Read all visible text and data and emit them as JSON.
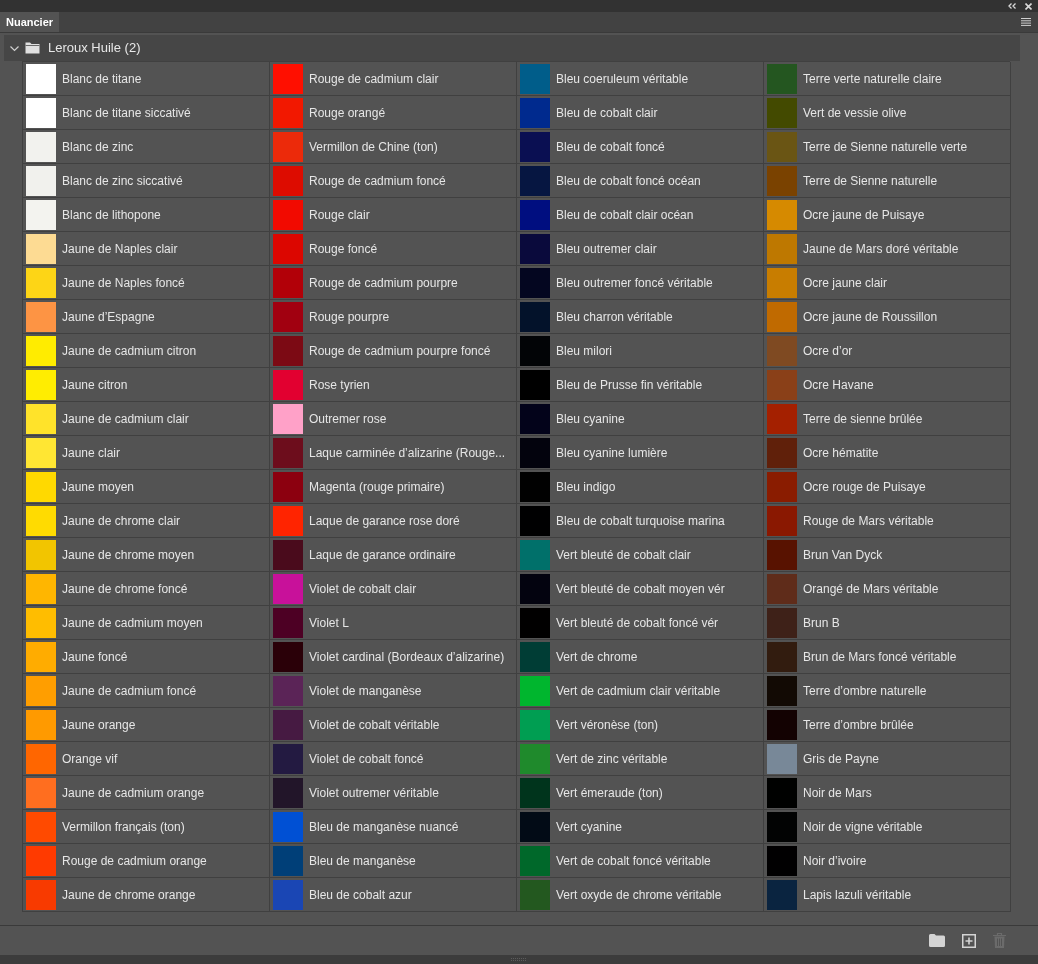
{
  "tabs": [
    {
      "label": "Nuancier",
      "selected": true
    }
  ],
  "group": {
    "name": "Leroux Huile (2)",
    "expanded": true
  },
  "swatches": [
    {
      "name": "Blanc de titane",
      "color": "#ffffff"
    },
    {
      "name": "Blanc de titane siccativé",
      "color": "#ffffff"
    },
    {
      "name": "Blanc de zinc",
      "color": "#f2f2ee"
    },
    {
      "name": "Blanc de zinc siccativé",
      "color": "#f1f1ed"
    },
    {
      "name": "Blanc de lithopone",
      "color": "#f3f3ef"
    },
    {
      "name": "Jaune de Naples clair",
      "color": "#fddb93"
    },
    {
      "name": "Jaune de Naples foncé",
      "color": "#fdd516"
    },
    {
      "name": "Jaune d’Espagne",
      "color": "#fd9444"
    },
    {
      "name": "Jaune de cadmium citron",
      "color": "#ffec00"
    },
    {
      "name": "Jaune citron",
      "color": "#ffed01"
    },
    {
      "name": "Jaune de cadmium clair",
      "color": "#ffe32a"
    },
    {
      "name": "Jaune clair",
      "color": "#ffe633"
    },
    {
      "name": "Jaune moyen",
      "color": "#ffd900"
    },
    {
      "name": "Jaune de chrome clair",
      "color": "#ffdb01"
    },
    {
      "name": "Jaune de chrome moyen",
      "color": "#f2c500"
    },
    {
      "name": "Jaune de chrome foncé",
      "color": "#ffb600"
    },
    {
      "name": "Jaune de cadmium moyen",
      "color": "#ffbd00"
    },
    {
      "name": "Jaune foncé",
      "color": "#ffac00"
    },
    {
      "name": "Jaune de cadmium foncé",
      "color": "#ff9e00"
    },
    {
      "name": "Jaune orange",
      "color": "#ff9a00"
    },
    {
      "name": "Orange vif",
      "color": "#ff6600"
    },
    {
      "name": "Jaune de cadmium orange",
      "color": "#ff6e1f"
    },
    {
      "name": "Vermillon français (ton)",
      "color": "#ff4a00"
    },
    {
      "name": "Rouge de cadmium orange",
      "color": "#ff3a00"
    },
    {
      "name": "Jaune de chrome orange",
      "color": "#f83a00"
    },
    {
      "name": "Rouge de cadmium clair",
      "color": "#ff0f00"
    },
    {
      "name": "Rouge orangé",
      "color": "#f21800"
    },
    {
      "name": "Vermillon de Chine (ton)",
      "color": "#ec2a0a"
    },
    {
      "name": "Rouge de cadmium foncé",
      "color": "#dd0c00"
    },
    {
      "name": "Rouge clair",
      "color": "#f20a00"
    },
    {
      "name": "Rouge foncé",
      "color": "#dc0600"
    },
    {
      "name": "Rouge de cadmium pourpre",
      "color": "#b20008"
    },
    {
      "name": "Rouge pourpre",
      "color": "#a10010"
    },
    {
      "name": "Rouge de cadmium pourpre foncé",
      "color": "#7c0a14"
    },
    {
      "name": "Rose tyrien",
      "color": "#e20030"
    },
    {
      "name": "Outremer rose",
      "color": "#ffa1c8"
    },
    {
      "name": "Laque carminée d’alizarine (Rouge...",
      "color": "#6d0d1c"
    },
    {
      "name": "Magenta (rouge primaire)",
      "color": "#8c000f"
    },
    {
      "name": "Laque de garance rose doré",
      "color": "#ff2400"
    },
    {
      "name": "Laque de garance ordinaire",
      "color": "#4a0b1c"
    },
    {
      "name": "Violet de cobalt clair",
      "color": "#c8119a"
    },
    {
      "name": "Violet L",
      "color": "#4d0024"
    },
    {
      "name": "Violet cardinal (Bordeaux d’alizarine)",
      "color": "#2a0008"
    },
    {
      "name": "Violet de manganèse",
      "color": "#5b2457"
    },
    {
      "name": "Violet de cobalt véritable",
      "color": "#461a42"
    },
    {
      "name": "Violet de cobalt foncé",
      "color": "#231a41"
    },
    {
      "name": "Violet outremer véritable",
      "color": "#221529"
    },
    {
      "name": "Bleu de manganèse nuancé",
      "color": "#0050d4"
    },
    {
      "name": "Bleu de manganèse",
      "color": "#003f78"
    },
    {
      "name": "Bleu de cobalt azur",
      "color": "#1a46b4"
    },
    {
      "name": "Bleu coeruleum véritable",
      "color": "#005d8a"
    },
    {
      "name": "Bleu de cobalt clair",
      "color": "#002a8e"
    },
    {
      "name": "Bleu de cobalt foncé",
      "color": "#0a0f52"
    },
    {
      "name": "Bleu de cobalt foncé océan",
      "color": "#061641"
    },
    {
      "name": "Bleu de cobalt clair océan",
      "color": "#000e80"
    },
    {
      "name": "Bleu outremer clair",
      "color": "#0a0a3c"
    },
    {
      "name": "Bleu outremer foncé véritable",
      "color": "#040620"
    },
    {
      "name": "Bleu charron véritable",
      "color": "#03122a"
    },
    {
      "name": "Bleu milori",
      "color": "#020406"
    },
    {
      "name": "Bleu de Prusse fin véritable",
      "color": "#000000"
    },
    {
      "name": "Bleu cyanine",
      "color": "#03031a"
    },
    {
      "name": "Bleu cyanine lumière",
      "color": "#03030d"
    },
    {
      "name": "Bleu indigo",
      "color": "#010101"
    },
    {
      "name": "Bleu de cobalt turquoise marina",
      "color": "#000001"
    },
    {
      "name": "Vert bleuté de cobalt clair",
      "color": "#00706a"
    },
    {
      "name": "Vert bleuté de cobalt moyen vér",
      "color": "#03030f"
    },
    {
      "name": "Vert bleuté de cobalt foncé vér",
      "color": "#010000"
    },
    {
      "name": "Vert de chrome",
      "color": "#003d35"
    },
    {
      "name": "Vert de cadmium clair véritable",
      "color": "#00b62e"
    },
    {
      "name": "Vert véronèse (ton)",
      "color": "#009e52"
    },
    {
      "name": "Vert de zinc véritable",
      "color": "#1f8a2c"
    },
    {
      "name": "Vert émeraude (ton)",
      "color": "#00341c"
    },
    {
      "name": "Vert cyanine",
      "color": "#020b16"
    },
    {
      "name": "Vert de cobalt foncé véritable",
      "color": "#00682a"
    },
    {
      "name": "Vert oxyde de chrome véritable",
      "color": "#23581f"
    },
    {
      "name": "Terre verte naturelle claire",
      "color": "#245620"
    },
    {
      "name": "Vert de vessie olive",
      "color": "#434a00"
    },
    {
      "name": "Terre de Sienne naturelle verte",
      "color": "#6a5514"
    },
    {
      "name": "Terre de Sienne naturelle",
      "color": "#7a4200"
    },
    {
      "name": "Ocre jaune de Puisaye",
      "color": "#d68a00"
    },
    {
      "name": "Jaune de Mars doré véritable",
      "color": "#be7800"
    },
    {
      "name": "Ocre jaune clair",
      "color": "#c87d00"
    },
    {
      "name": "Ocre jaune de Roussillon",
      "color": "#c06a00"
    },
    {
      "name": "Ocre d’or",
      "color": "#7f4a22"
    },
    {
      "name": "Ocre Havane",
      "color": "#8a4018"
    },
    {
      "name": "Terre de sienne brûlée",
      "color": "#a42000"
    },
    {
      "name": "Ocre hématite",
      "color": "#60200a"
    },
    {
      "name": "Ocre rouge de Puisaye",
      "color": "#8a1c00"
    },
    {
      "name": "Rouge de Mars véritable",
      "color": "#8a1801"
    },
    {
      "name": "Brun Van Dyck",
      "color": "#581200"
    },
    {
      "name": "Orangé de Mars véritable",
      "color": "#5f2c1a"
    },
    {
      "name": "Brun B",
      "color": "#3e2118"
    },
    {
      "name": "Brun de Mars foncé véritable",
      "color": "#321c0f"
    },
    {
      "name": "Terre d’ombre naturelle",
      "color": "#120a04"
    },
    {
      "name": "Terre d’ombre brûlée",
      "color": "#130202"
    },
    {
      "name": "Gris de Payne",
      "color": "#788898"
    },
    {
      "name": "Noir de Mars",
      "color": "#000100"
    },
    {
      "name": "Noir de vigne véritable",
      "color": "#020303"
    },
    {
      "name": "Noir d’ivoire",
      "color": "#010001"
    },
    {
      "name": "Lapis lazuli véritable",
      "color": "#0a2440"
    }
  ],
  "toolbar": [
    {
      "kind": "new-group",
      "disabled": false
    },
    {
      "kind": "new-swatch",
      "disabled": false
    },
    {
      "kind": "delete",
      "disabled": true
    }
  ]
}
